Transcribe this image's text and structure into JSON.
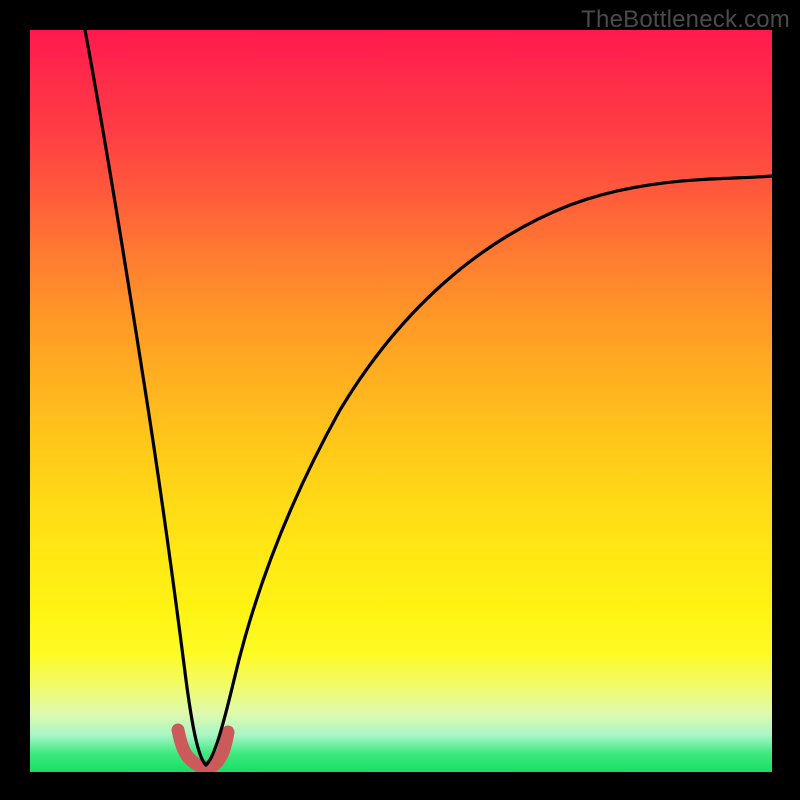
{
  "watermark": "TheBottleneck.com",
  "chart_data": {
    "type": "line",
    "title": "",
    "xlabel": "",
    "ylabel": "",
    "xlim": [
      0,
      100
    ],
    "ylim": [
      0,
      100
    ],
    "grid": false,
    "legend": false,
    "series": [
      {
        "name": "left-curve",
        "x": [
          7.5,
          9,
          10.5,
          12,
          13.5,
          15,
          16.5,
          18,
          19,
          19.8,
          20.5,
          21,
          21.5,
          22,
          22.6
        ],
        "values": [
          100,
          86,
          73,
          60,
          48,
          36,
          25,
          15,
          9.5,
          5.5,
          3.2,
          2.2,
          1.6,
          1.2,
          1.0
        ]
      },
      {
        "name": "right-curve",
        "x": [
          23.2,
          23.8,
          24.5,
          25.3,
          26.3,
          27.5,
          29,
          31,
          34,
          38,
          43,
          49,
          56,
          64,
          72,
          80,
          88,
          96,
          100
        ],
        "values": [
          1.0,
          1.3,
          2.0,
          3.0,
          4.5,
          6.3,
          8.8,
          12.2,
          17,
          23,
          30,
          38,
          46,
          54,
          61,
          67.5,
          73,
          78,
          80.5
        ]
      },
      {
        "name": "trough-band",
        "x": [
          20,
          21,
          22,
          23,
          24,
          25,
          26
        ],
        "values": [
          5.5,
          2.2,
          1.2,
          1.0,
          2.0,
          3.0,
          4.5
        ]
      }
    ],
    "colors": {
      "curve": "#000000",
      "trough_marker": "#cc5a5a",
      "gradient_top": "#ff1a4d",
      "gradient_mid": "#ffd617",
      "gradient_bottom": "#16df66"
    }
  }
}
